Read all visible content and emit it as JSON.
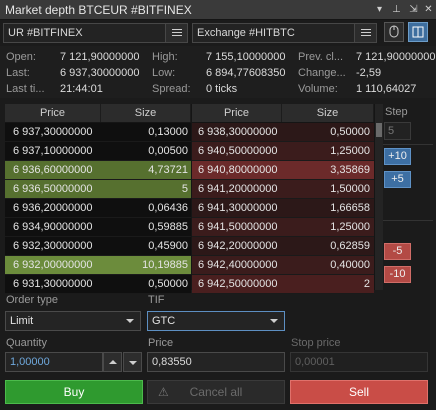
{
  "window": {
    "title": "Market depth BTCEUR  #BITFINEX"
  },
  "exchange_left": {
    "label": "UR  #BITFINEX",
    "list_icon": "list-icon"
  },
  "exchange_right": {
    "label": "Exchange  #HITBTC",
    "list_icon": "list-icon"
  },
  "toolbar": {
    "mouse_icon": "mouse-icon",
    "split_icon": "split-view-icon"
  },
  "stats": {
    "open_label": "Open:",
    "open_value": "7 121,90000000",
    "last_label": "Last:",
    "last_value": "6 937,30000000",
    "last_time_label": "Last ti...",
    "last_time_value": "21:44:01",
    "high_label": "High:",
    "high_value": "7 155,10000000",
    "low_label": "Low:",
    "low_value": "6 894,77608350",
    "spread_label": "Spread:",
    "spread_value": "0 ticks",
    "prev_label": "Prev. cl...",
    "prev_value": "7 121,90000000",
    "change_label": "Change...",
    "change_value": "-2,59",
    "volume_label": "Volume:",
    "volume_value": "1 110,64027"
  },
  "book": {
    "headers": {
      "bid_price": "Price",
      "bid_size": "Size",
      "ask_price": "Price",
      "ask_size": "Size"
    },
    "bids": [
      {
        "price": "6 937,30000000",
        "size": "0,13000",
        "bg": "#0f0f0f"
      },
      {
        "price": "6 937,10000000",
        "size": "0,00500",
        "bg": "#0f0f0f"
      },
      {
        "price": "6 936,60000000",
        "size": "4,73721",
        "bg": "#56702f"
      },
      {
        "price": "6 936,50000000",
        "size": "5",
        "bg": "#56702f"
      },
      {
        "price": "6 936,20000000",
        "size": "0,06436",
        "bg": "#0f0f0f"
      },
      {
        "price": "6 934,90000000",
        "size": "0,59885",
        "bg": "#0f0f0f"
      },
      {
        "price": "6 932,30000000",
        "size": "0,45900",
        "bg": "#0f0f0f"
      },
      {
        "price": "6 932,00000000",
        "size": "10,19885",
        "bg": "#6c8c3c"
      },
      {
        "price": "6 931,30000000",
        "size": "0,50000",
        "bg": "#0f0f0f"
      }
    ],
    "asks": [
      {
        "price": "6 938,30000000",
        "size": "0,50000",
        "bg": "#2c1818"
      },
      {
        "price": "6 940,50000000",
        "size": "1,25000",
        "bg": "#3b1c1c"
      },
      {
        "price": "6 940,80000000",
        "size": "3,35869",
        "bg": "#6b2a2a"
      },
      {
        "price": "6 941,20000000",
        "size": "1,50000",
        "bg": "#3b1c1c"
      },
      {
        "price": "6 941,30000000",
        "size": "1,66658",
        "bg": "#2c1818"
      },
      {
        "price": "6 941,50000000",
        "size": "1,25000",
        "bg": "#3b1c1c"
      },
      {
        "price": "6 942,20000000",
        "size": "0,62859",
        "bg": "#2c1818"
      },
      {
        "price": "6 942,40000000",
        "size": "0,40000",
        "bg": "#3b1c1c"
      },
      {
        "price": "6 942,50000000",
        "size": "2",
        "bg": "#4a1f1f"
      }
    ]
  },
  "side": {
    "step_label": "Step",
    "step_value": "5",
    "plus10": "+10",
    "plus5": "+5",
    "minus5": "-5",
    "minus10": "-10"
  },
  "order": {
    "type_label": "Order type",
    "type_value": "Limit",
    "tif_label": "TIF",
    "tif_value": "GTC",
    "qty_label": "Quantity",
    "qty_value": "1,00000",
    "price_label": "Price",
    "price_value": "0,83550",
    "stop_label": "Stop price",
    "stop_value": "0,00001"
  },
  "buttons": {
    "buy": "Buy",
    "cancel_all": "Cancel all",
    "sell": "Sell"
  },
  "colors": {
    "buy": "#2f9a2f",
    "sell": "#c94d47",
    "accent": "#3d6fa3"
  }
}
